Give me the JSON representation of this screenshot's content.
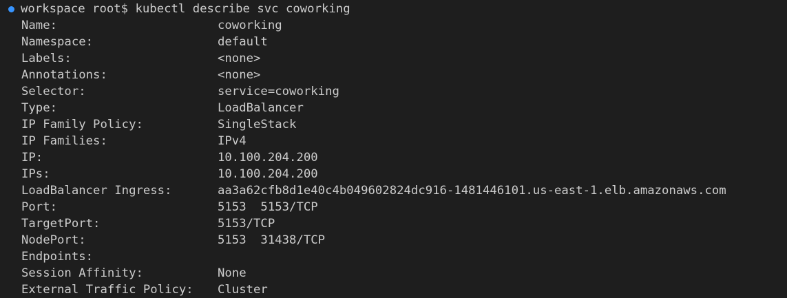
{
  "terminal": {
    "status_dot_color": "#3794ff",
    "prompt": "workspace root$",
    "command": "kubectl describe svc coworking",
    "rows": [
      {
        "key": "Name:",
        "value": "coworking"
      },
      {
        "key": "Namespace:",
        "value": "default"
      },
      {
        "key": "Labels:",
        "value": "<none>"
      },
      {
        "key": "Annotations:",
        "value": "<none>"
      },
      {
        "key": "Selector:",
        "value": "service=coworking"
      },
      {
        "key": "Type:",
        "value": "LoadBalancer"
      },
      {
        "key": "IP Family Policy:",
        "value": "SingleStack"
      },
      {
        "key": "IP Families:",
        "value": "IPv4"
      },
      {
        "key": "IP:",
        "value": "10.100.204.200"
      },
      {
        "key": "IPs:",
        "value": "10.100.204.200"
      },
      {
        "key": "LoadBalancer Ingress:",
        "value": "aa3a62cfb8d1e40c4b049602824dc916-1481446101.us-east-1.elb.amazonaws.com"
      },
      {
        "key": "Port:",
        "value": "5153  5153/TCP"
      },
      {
        "key": "TargetPort:",
        "value": "5153/TCP"
      },
      {
        "key": "NodePort:",
        "value": "5153  31438/TCP"
      },
      {
        "key": "Endpoints:",
        "value": ""
      },
      {
        "key": "Session Affinity:",
        "value": "None"
      },
      {
        "key": "External Traffic Policy:",
        "value": "Cluster"
      }
    ]
  }
}
